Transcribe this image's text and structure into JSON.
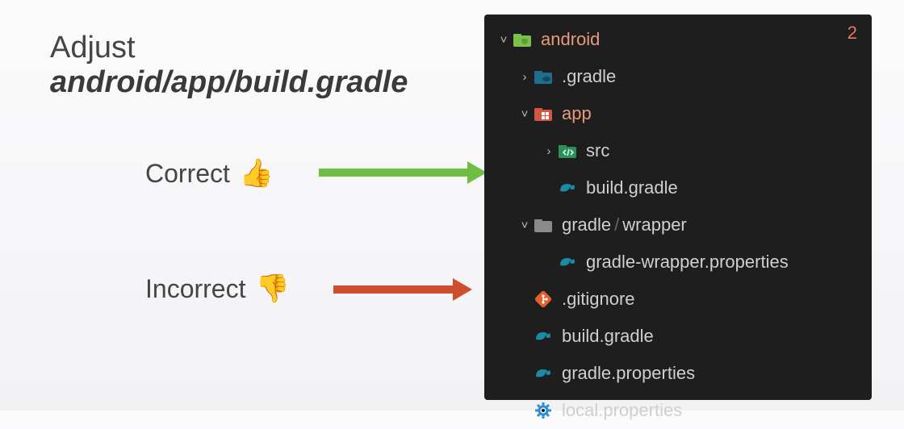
{
  "instructions": {
    "line1": "Adjust",
    "line2": "android/app/build.gradle",
    "correct_label": "Correct",
    "correct_emoji": "👍",
    "incorrect_label": "Incorrect",
    "incorrect_emoji": "👎"
  },
  "tree": {
    "badge": "2",
    "nodes": {
      "android": {
        "label": "android",
        "chev": "˅"
      },
      "gradleDir": {
        "label": ".gradle",
        "chev": "›"
      },
      "app": {
        "label": "app",
        "chev": "˅"
      },
      "src": {
        "label": "src",
        "chev": "›"
      },
      "buildApp": {
        "label": "build.gradle"
      },
      "gradleWrap": {
        "label_a": "gradle",
        "sep": "/",
        "label_b": "wrapper",
        "chev": "˅"
      },
      "gwp": {
        "label": "gradle-wrapper.properties"
      },
      "gitignore": {
        "label": ".gitignore"
      },
      "buildRoot": {
        "label": "build.gradle"
      },
      "gprops": {
        "label": "gradle.properties"
      },
      "lprops": {
        "label": "local.properties"
      }
    }
  },
  "colors": {
    "accent_orange": "#e89b78",
    "arrow_green": "#6fbe44",
    "arrow_red": "#cc4f2e",
    "panel_bg": "#1e1e1e"
  }
}
